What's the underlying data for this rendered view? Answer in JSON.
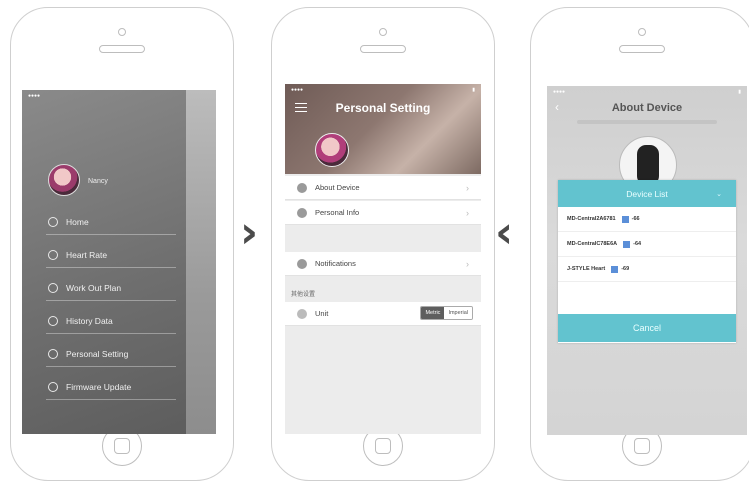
{
  "phone1": {
    "username": "Nancy",
    "menu": [
      "Home",
      "Heart Rate",
      "Work Out Plan",
      "History Data",
      "Personal Setting",
      "Firmware Update"
    ]
  },
  "phone2": {
    "title": "Personal Setting",
    "rows": {
      "about": "About Device",
      "info": "Personal Info",
      "notif": "Notifications"
    },
    "section_label": "其他设置",
    "unit_label": "Unit",
    "unit_options": [
      "Metric",
      "Imperial"
    ],
    "selected_unit": "Metric"
  },
  "phone3": {
    "title": "About Device",
    "dialog_title": "Device List",
    "devices": [
      {
        "name": "MD-Central2A6781",
        "rssi": "-66"
      },
      {
        "name": "MD-CentralC78E6A",
        "rssi": "-64"
      },
      {
        "name": "J-STYLE Heart",
        "rssi": "-69"
      }
    ],
    "cancel": "Cancel"
  },
  "arrows": {
    "right": "›",
    "left": "‹"
  },
  "colors": {
    "accent_teal": "#62c3cf"
  }
}
